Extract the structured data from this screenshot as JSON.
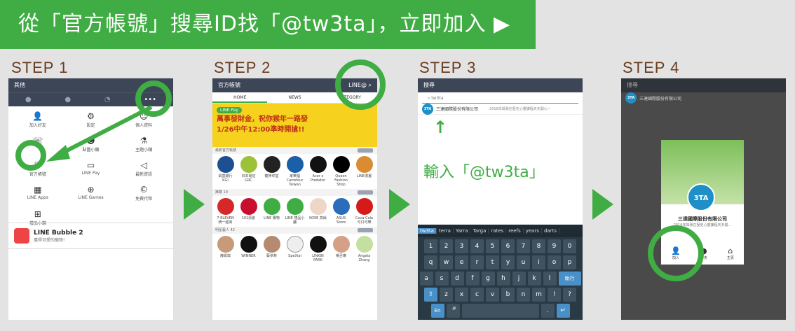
{
  "banner": {
    "text": "從「官方帳號」搜尋ID找「@tw3ta」，立即加入 ▶"
  },
  "steps": {
    "s1": "STEP 1",
    "s2": "STEP 2",
    "s3": "STEP 3",
    "s4": "STEP 4"
  },
  "colors": {
    "accent": "#3fad43",
    "header": "#3c4657",
    "step_text": "#6b3d20"
  },
  "phone1": {
    "header": "其他",
    "grid": [
      {
        "icon": "add-friend-icon",
        "label": "加入好友"
      },
      {
        "icon": "gear-icon",
        "label": "設定"
      },
      {
        "icon": "profile-icon",
        "label": "個人資料"
      },
      {
        "icon": "phone-icon",
        "label": ""
      },
      {
        "icon": "sticker-shop-icon",
        "label": "貼圖小舖"
      },
      {
        "icon": "theme-shop-icon",
        "label": "主題小舖"
      },
      {
        "icon": "official-account-icon",
        "label": "官方帳號"
      },
      {
        "icon": "line-pay-icon",
        "label": "LINE Pay"
      },
      {
        "icon": "announcement-icon",
        "label": "最新資訊"
      },
      {
        "icon": "apps-icon",
        "label": "LINE Apps"
      },
      {
        "icon": "games-icon",
        "label": "LINE Games"
      },
      {
        "icon": "coin-icon",
        "label": "免費代幣"
      },
      {
        "icon": "gift-icon",
        "label": "禮品小舖"
      }
    ],
    "bubble": {
      "title": "LINE Bubble 2",
      "sub": "獲得可愛的寵物!"
    }
  },
  "phone2": {
    "header": "官方帳號",
    "header_right": "LINE@",
    "tabs": [
      "HOME",
      "NEWS",
      "CATEGORY"
    ],
    "banner_pill": "LINE Pay",
    "banner_line1": "萬事發財金，祝你猴年一路發",
    "banner_line2": "1/26中午12:00準時開搶!!",
    "sec1": "最新官方帳號",
    "sec2": "推薦 19",
    "sec3": "明星藝人 42",
    "row1": [
      "凱基銀行 KGI",
      "日本電信 GRC",
      "龍神印堂",
      "家樂福 Carrefour Taiwan",
      "Acer x Predator",
      "Queen Fashion Shop",
      "LINE漫畫"
    ],
    "row2": [
      "7-ELEVEN 統一超商",
      "101原創",
      "LINE 購物",
      "LINE 禮品小舖",
      "KOSE 高絲",
      "ASUS Store",
      "Coca-Cola 可口可樂"
    ],
    "row3": [
      "薛凱琪",
      "WINNER",
      "蔡依林",
      "SpeXial",
      "LINKIN PARK",
      "楊丞琳",
      "Angela Zhang"
    ]
  },
  "phone3": {
    "header": "搜尋",
    "search": "tw3ta",
    "result_name": "三達國際股份有限公司",
    "result_note": "2016年與我在歷史心靈課程天天開心~",
    "logo": "3TA",
    "typed": "輸入「@tw3ta」",
    "suggestions": [
      "tw3ta",
      "terra",
      "Yarra",
      "Targa",
      "rates",
      "reefs",
      "years",
      "darts"
    ],
    "keys1": [
      "1",
      "2",
      "3",
      "4",
      "5",
      "6",
      "7",
      "8",
      "9",
      "0"
    ],
    "keys2": [
      "q",
      "w",
      "e",
      "r",
      "t",
      "y",
      "u",
      "i",
      "o",
      "p"
    ],
    "keys3": [
      "a",
      "s",
      "d",
      "f",
      "g",
      "h",
      "j",
      "k",
      "l"
    ],
    "keys4": [
      "z",
      "x",
      "c",
      "v",
      "b",
      "n",
      "m",
      "!",
      "?"
    ],
    "enter": "執行",
    "lang": "En"
  },
  "phone4": {
    "header": "搜尋",
    "result_name": "三達國際股份有限公司",
    "logo": "3TA",
    "card_name": "三達國際股份有限公司",
    "card_sub": "2016年與我在歷史心靈課程天天開...",
    "btn_add": "加入",
    "btn_chat": "聊天",
    "btn_home": "主頁"
  }
}
